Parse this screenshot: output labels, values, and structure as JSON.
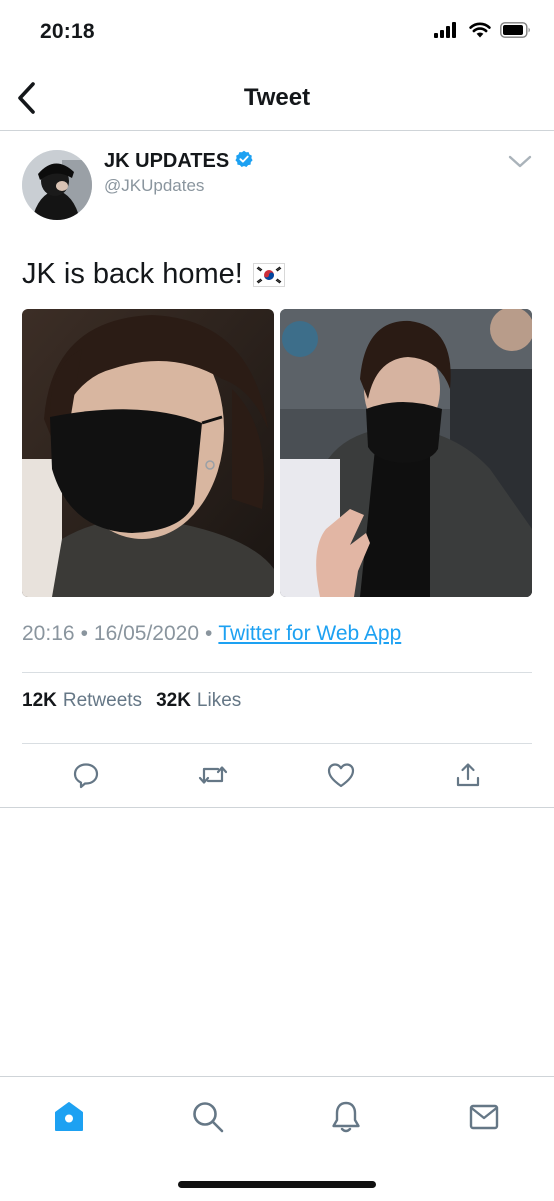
{
  "status_bar": {
    "time": "20:18"
  },
  "nav": {
    "title": "Tweet",
    "back_icon": "chevron-left-icon"
  },
  "tweet": {
    "display_name": "JK UPDATES",
    "handle": "@JKUpdates",
    "verified": true,
    "text": "JK is back home!",
    "emoji": "south-korea-flag",
    "time": "20:16",
    "separator": "•",
    "date": "16/05/2020",
    "source": "Twitter for Web App",
    "stats": {
      "retweets_count": "12K",
      "retweets_label": "Retweets",
      "likes_count": "32K",
      "likes_label": "Likes"
    },
    "actions": [
      "reply-icon",
      "retweet-icon",
      "like-icon",
      "share-icon"
    ]
  },
  "tab_bar": {
    "items": [
      "home-icon",
      "search-icon",
      "notifications-icon",
      "messages-icon"
    ],
    "active": "home-icon"
  },
  "colors": {
    "accent": "#1da1f2",
    "text_primary": "#14171a",
    "text_secondary": "#8a959e",
    "divider": "#cfd4d8"
  }
}
